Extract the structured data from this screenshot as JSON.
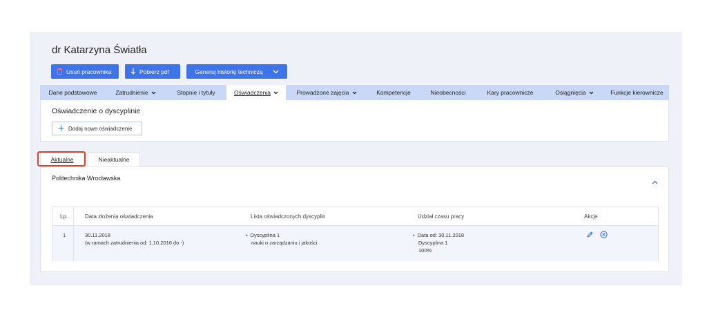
{
  "page": {
    "title": "dr Katarzyna Światła"
  },
  "toolbar": {
    "delete_label": "Usuń pracownika",
    "pdf_label": "Pobierz pdf",
    "generate_label": "Generuj historię techniczą"
  },
  "nav": {
    "items": [
      {
        "label": "Dane podstawowe",
        "dropdown": false
      },
      {
        "label": "Zatrudnienie",
        "dropdown": true
      },
      {
        "label": "Stopnie i tytuły",
        "dropdown": false
      },
      {
        "label": "Oświadczenia",
        "dropdown": true,
        "active": true
      },
      {
        "label": "Prowadzone zajęcia",
        "dropdown": true
      },
      {
        "label": "Kompetencje",
        "dropdown": false
      },
      {
        "label": "Nieobecności",
        "dropdown": false
      },
      {
        "label": "Kary pracownicze",
        "dropdown": false
      },
      {
        "label": "Osiągnięcia",
        "dropdown": true
      },
      {
        "label": "Funkcje kierownicze",
        "dropdown": false
      }
    ]
  },
  "section": {
    "title": "Oświadczenie o dyscyplinie",
    "add_label": "Dodaj nowe oświadczenie"
  },
  "tabs": {
    "current": "Aktualne",
    "outdated": "Nieaktualne"
  },
  "institution": {
    "name": "Politechnika Wrocławska"
  },
  "table": {
    "headers": {
      "lp": "Lp.",
      "date": "Data złożenia oświadczenia",
      "list": "Lista oświadczonych dyscyplin",
      "share": "Udział czasu pracy",
      "actions": "Akcje"
    },
    "rows": [
      {
        "lp": "1",
        "date": "30.11.2018",
        "date_note": "(w ramach zatrudnienia od: 1.10.2016 do -)",
        "discipline": "Dyscyplina 1",
        "discipline_name": "nauki o zarządzaniu i jakości",
        "share_date": "Data od: 30.11.2018",
        "share_discipline": "Dyscyplina 1",
        "share_percent": "100%"
      }
    ]
  },
  "colors": {
    "primary": "#3f73e8",
    "nav_bg": "#c9d8f7",
    "highlight": "#d9432e",
    "page_bg": "#eef1f8"
  }
}
